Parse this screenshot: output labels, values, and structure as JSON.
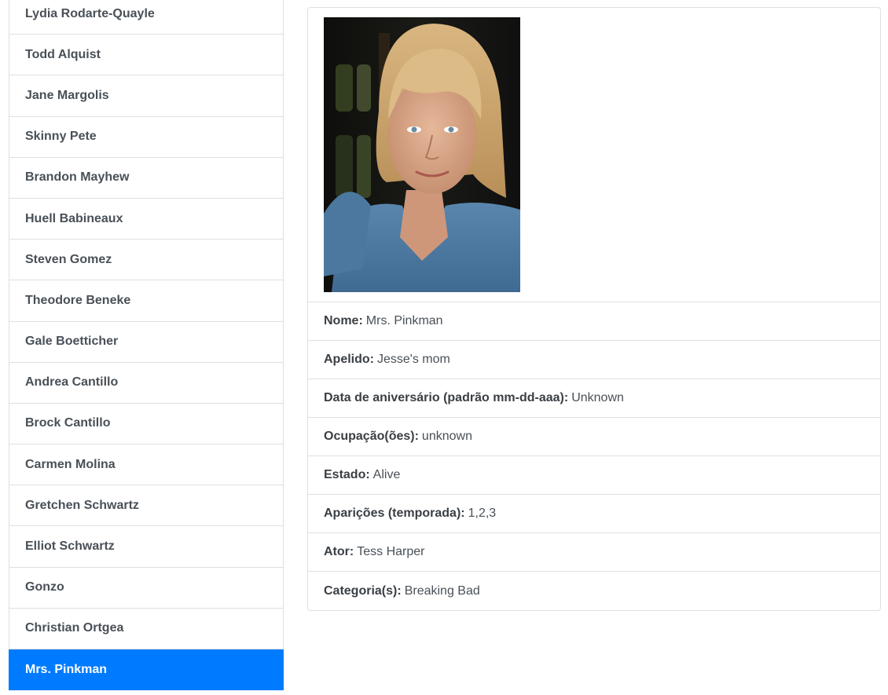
{
  "sidebar": {
    "items": [
      {
        "label": "Lydia Rodarte-Quayle",
        "active": false
      },
      {
        "label": "Todd Alquist",
        "active": false
      },
      {
        "label": "Jane Margolis",
        "active": false
      },
      {
        "label": "Skinny Pete",
        "active": false
      },
      {
        "label": "Brandon Mayhew",
        "active": false
      },
      {
        "label": "Huell Babineaux",
        "active": false
      },
      {
        "label": "Steven Gomez",
        "active": false
      },
      {
        "label": "Theodore Beneke",
        "active": false
      },
      {
        "label": "Gale Boetticher",
        "active": false
      },
      {
        "label": "Andrea Cantillo",
        "active": false
      },
      {
        "label": "Brock Cantillo",
        "active": false
      },
      {
        "label": "Carmen Molina",
        "active": false
      },
      {
        "label": "Gretchen Schwartz",
        "active": false
      },
      {
        "label": "Elliot Schwartz",
        "active": false
      },
      {
        "label": "Gonzo",
        "active": false
      },
      {
        "label": "Christian Ortgea",
        "active": false
      },
      {
        "label": "Mrs. Pinkman",
        "active": true
      }
    ]
  },
  "detail": {
    "rows": [
      {
        "label": "Nome:",
        "value": "Mrs. Pinkman"
      },
      {
        "label": "Apelido:",
        "value": "Jesse's mom"
      },
      {
        "label": "Data de aniversário (padrão mm-dd-aaa):",
        "value": "Unknown"
      },
      {
        "label": "Ocupação(ões):",
        "value": "unknown"
      },
      {
        "label": "Estado:",
        "value": "Alive"
      },
      {
        "label": "Aparições (temporada):",
        "value": "1,2,3"
      },
      {
        "label": "Ator:",
        "value": "Tess Harper"
      },
      {
        "label": "Categoria(s):",
        "value": "Breaking Bad"
      }
    ]
  },
  "colors": {
    "active": "#007bff",
    "border": "#dfdfdf",
    "text": "#495057"
  }
}
